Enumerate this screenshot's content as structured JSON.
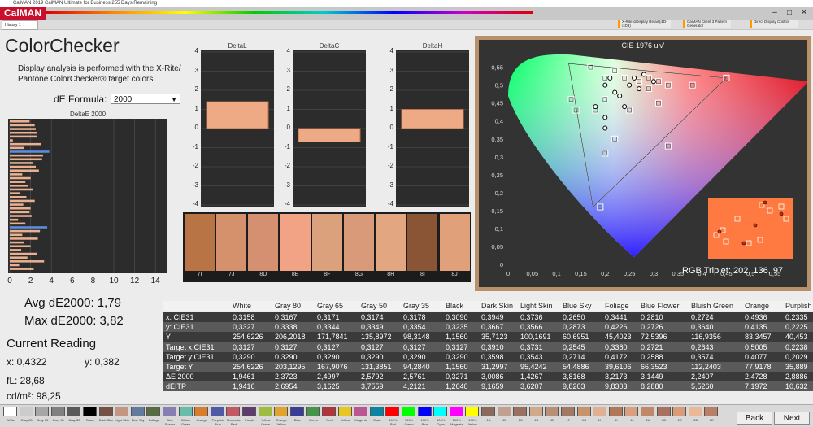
{
  "titlebar": {
    "text": "CalMAN 2019 CalMAN Ultimate for Business 255 Days Remaining"
  },
  "brand": {
    "logo": "CalMAN",
    "color": "#c8102e"
  },
  "tabs": [
    {
      "label": "History 1"
    }
  ],
  "devices": [
    {
      "label": "X-Rite i1Display Retail (i1D-i1D3)"
    },
    {
      "label": "CalMAN Client 3 Pattern Generator"
    },
    {
      "label": "Direct Display Control"
    }
  ],
  "page": {
    "title": "ColorChecker",
    "description": "Display analysis is performed with the X-Rite/ Pantone ColorChecker® target colors.",
    "de_formula_label": "dE Formula:",
    "de_formula_value": "2000"
  },
  "de2000_chart": {
    "title": "DeltaE 2000",
    "x_ticks": [
      "0",
      "2",
      "4",
      "6",
      "8",
      "10",
      "12",
      "14"
    ],
    "bars": [
      1.9,
      2.4,
      2.5,
      2.6,
      2.6,
      0.3,
      3.0,
      1.4,
      3.8,
      3.2,
      3.1,
      2.2,
      2.5,
      2.8,
      1.2,
      2.0,
      1.5,
      1.8,
      2.2,
      1.0,
      1.6,
      2.4,
      1.3,
      2.0,
      1.9,
      2.1,
      0.8,
      1.5,
      3.6,
      2.9,
      1.2,
      2.7,
      1.4,
      2.0,
      1.1,
      2.6,
      1.7,
      3.3,
      0.9,
      2.3
    ]
  },
  "delta_charts": [
    {
      "title": "DeltaL",
      "value": 1.4
    },
    {
      "title": "DeltaC",
      "value": -0.7
    },
    {
      "title": "DeltaH",
      "value": 1.0
    }
  ],
  "delta_ticks": [
    "4",
    "3",
    "2",
    "1",
    "0",
    "-1",
    "-2",
    "-3",
    "-4"
  ],
  "patches": [
    {
      "label": "7I",
      "color": "#b87444"
    },
    {
      "label": "7J",
      "color": "#d4916c"
    },
    {
      "label": "8D",
      "color": "#d49070"
    },
    {
      "label": "8E",
      "color": "#f2a385"
    },
    {
      "label": "8F",
      "color": "#dba07c"
    },
    {
      "label": "8G",
      "color": "#d89a79"
    },
    {
      "label": "8H",
      "color": "#e2a780"
    },
    {
      "label": "8I",
      "color": "#8a5534"
    },
    {
      "label": "8J",
      "color": "#e0a07a"
    }
  ],
  "stats": {
    "avg": "Avg dE2000: 1,79",
    "max": "Max dE2000: 3,82",
    "current_reading": "Current Reading",
    "x": "x: 0,4322",
    "y": "y: 0,382",
    "fl": "fL: 28,68",
    "cdm2": "cd/m²: 98,25"
  },
  "cie": {
    "title": "CIE 1976 u'v'",
    "y_ticks": [
      "0,55",
      "0,5",
      "0,45",
      "0,4",
      "0,35",
      "0,3",
      "0,25",
      "0,2",
      "0,15",
      "0,1",
      "0,05",
      "0"
    ],
    "x_ticks": [
      "0",
      "0,05",
      "0,1",
      "0,15",
      "0,2",
      "0,25",
      "0,3",
      "0,35",
      "0,4",
      "0,45",
      "0,5",
      "0,55"
    ],
    "rgb_triplet": "RGB Triplet: 202, 136, 97",
    "targets": [
      [
        0.17,
        0.55
      ],
      [
        0.22,
        0.54
      ],
      [
        0.2,
        0.52
      ],
      [
        0.31,
        0.51
      ],
      [
        0.29,
        0.52
      ],
      [
        0.24,
        0.52
      ],
      [
        0.27,
        0.51
      ],
      [
        0.33,
        0.5
      ],
      [
        0.38,
        0.5
      ],
      [
        0.45,
        0.52
      ],
      [
        0.13,
        0.46
      ],
      [
        0.14,
        0.43
      ],
      [
        0.18,
        0.43
      ],
      [
        0.2,
        0.46
      ],
      [
        0.25,
        0.43
      ],
      [
        0.22,
        0.35
      ],
      [
        0.2,
        0.31
      ],
      [
        0.33,
        0.33
      ],
      [
        0.19,
        0.16
      ],
      [
        0.31,
        0.45
      ],
      [
        0.29,
        0.49
      ]
    ],
    "measured": [
      [
        0.2,
        0.5
      ],
      [
        0.21,
        0.52
      ],
      [
        0.23,
        0.47
      ],
      [
        0.26,
        0.52
      ],
      [
        0.28,
        0.53
      ],
      [
        0.3,
        0.51
      ],
      [
        0.25,
        0.5
      ],
      [
        0.2,
        0.41
      ],
      [
        0.2,
        0.38
      ],
      [
        0.24,
        0.44
      ],
      [
        0.18,
        0.44
      ],
      [
        0.22,
        0.48
      ],
      [
        0.27,
        0.49
      ]
    ]
  },
  "table": {
    "columns": [
      "",
      "White",
      "Gray 80",
      "Gray 65",
      "Gray 50",
      "Gray 35",
      "Black",
      "Dark Skin",
      "Light Skin",
      "Blue Sky",
      "Foliage",
      "Blue Flower",
      "Bluish Green",
      "Orange",
      "Purplish"
    ],
    "rows": [
      [
        "x: CIE31",
        "0,3158",
        "0,3167",
        "0,3171",
        "0,3174",
        "0,3178",
        "0,3090",
        "0,3949",
        "0,3736",
        "0,2650",
        "0,3441",
        "0,2810",
        "0,2724",
        "0,4936",
        "0,2335"
      ],
      [
        "y: CIE31",
        "0,3327",
        "0,3338",
        "0,3344",
        "0,3349",
        "0,3354",
        "0,3235",
        "0,3667",
        "0,3566",
        "0,2873",
        "0,4226",
        "0,2726",
        "0,3640",
        "0,4135",
        "0,2225"
      ],
      [
        "Y",
        "254,6226",
        "206,2018",
        "171,7841",
        "135,8972",
        "98,3148",
        "1,1560",
        "35,7123",
        "100,1691",
        "60,6951",
        "45,4023",
        "72,5396",
        "116,9356",
        "83,3457",
        "40,453"
      ],
      [
        "Target x:CIE31",
        "0,3127",
        "0,3127",
        "0,3127",
        "0,3127",
        "0,3127",
        "0,3127",
        "0,3910",
        "0,3731",
        "0,2545",
        "0,3380",
        "0,2721",
        "0,2643",
        "0,5005",
        "0,2238"
      ],
      [
        "Target y:CIE31",
        "0,3290",
        "0,3290",
        "0,3290",
        "0,3290",
        "0,3290",
        "0,3290",
        "0,3598",
        "0,3543",
        "0,2714",
        "0,4172",
        "0,2588",
        "0,3574",
        "0,4077",
        "0,2029"
      ],
      [
        "Target Y",
        "254,6226",
        "203,1295",
        "167,9076",
        "131,3851",
        "94,2840",
        "1,1560",
        "31,2997",
        "95,4242",
        "54,4886",
        "39,6106",
        "66,3523",
        "112,2403",
        "77,9178",
        "35,889"
      ],
      [
        "ΔE 2000",
        "1,9461",
        "2,3723",
        "2,4997",
        "2,5792",
        "2,5761",
        "0,3271",
        "3,0086",
        "1,4267",
        "3,8168",
        "3,2173",
        "3,1449",
        "2,2407",
        "2,4728",
        "2,8886"
      ],
      [
        "dEITP",
        "1,9416",
        "2,6954",
        "3,1625",
        "3,7559",
        "4,2121",
        "1,2640",
        "9,1659",
        "3,6207",
        "9,8203",
        "9,8303",
        "8,2880",
        "5,5260",
        "7,1972",
        "10,632"
      ]
    ]
  },
  "swatches": [
    {
      "label": "White",
      "color": "#ffffff"
    },
    {
      "label": "Gray 80",
      "color": "#cccccc"
    },
    {
      "label": "Gray 65",
      "color": "#a6a6a6"
    },
    {
      "label": "Gray 50",
      "color": "#808080"
    },
    {
      "label": "Gray 35",
      "color": "#595959"
    },
    {
      "label": "Black",
      "color": "#000000"
    },
    {
      "label": "Dark Skin",
      "color": "#735244"
    },
    {
      "label": "Light Skin",
      "color": "#c29682"
    },
    {
      "label": "Blue Sky",
      "color": "#627a9d"
    },
    {
      "label": "Foliage",
      "color": "#576c43"
    },
    {
      "label": "Blue Flower",
      "color": "#8580b1"
    },
    {
      "label": "Bluish Green",
      "color": "#67bdaa"
    },
    {
      "label": "Orange",
      "color": "#d67e2c"
    },
    {
      "label": "Purplish Blue",
      "color": "#505ba6"
    },
    {
      "label": "Moderate Red",
      "color": "#c15a63"
    },
    {
      "label": "Purple",
      "color": "#5e3c6c"
    },
    {
      "label": "Yellow Green",
      "color": "#9dbc40"
    },
    {
      "label": "Orange Yellow",
      "color": "#e0a32e"
    },
    {
      "label": "Blue",
      "color": "#383d96"
    },
    {
      "label": "Green",
      "color": "#469449"
    },
    {
      "label": "Red",
      "color": "#af363c"
    },
    {
      "label": "Yellow",
      "color": "#e7c71f"
    },
    {
      "label": "Magenta",
      "color": "#bb5695"
    },
    {
      "label": "Cyan",
      "color": "#0885a1"
    },
    {
      "label": "100% Red",
      "color": "#ff0000"
    },
    {
      "label": "100% Green",
      "color": "#00ff00"
    },
    {
      "label": "100% Blue",
      "color": "#0000ff"
    },
    {
      "label": "100% Cyan",
      "color": "#00ffff"
    },
    {
      "label": "100% Magenta",
      "color": "#ff00ff"
    },
    {
      "label": "100% Yellow",
      "color": "#ffff00"
    },
    {
      "label": "1A",
      "color": "#8a6a5a"
    },
    {
      "label": "1B",
      "color": "#c0a090"
    },
    {
      "label": "1C",
      "color": "#9a7060"
    },
    {
      "label": "1D",
      "color": "#d0a88c"
    },
    {
      "label": "1E",
      "color": "#b89078"
    },
    {
      "label": "1F",
      "color": "#a07a64"
    },
    {
      "label": "1G",
      "color": "#c8946c"
    },
    {
      "label": "1H",
      "color": "#e0b094"
    },
    {
      "label": "1I",
      "color": "#b07858"
    },
    {
      "label": "1J",
      "color": "#d8a080"
    },
    {
      "label": "2A",
      "color": "#c08868"
    },
    {
      "label": "2B",
      "color": "#a87060"
    },
    {
      "label": "2C",
      "color": "#d89c78"
    },
    {
      "label": "2D",
      "color": "#e8b898"
    },
    {
      "label": "2E",
      "color": "#b88068"
    }
  ],
  "nav": {
    "back": "Back",
    "next": "Next"
  }
}
